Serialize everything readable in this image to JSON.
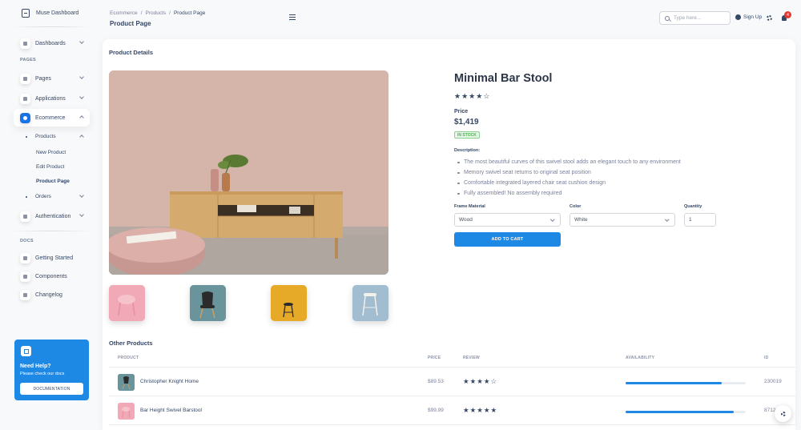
{
  "brand": {
    "name": "Muse Dashboard"
  },
  "sidebar": {
    "dashboards": "Dashboards",
    "section_pages": "PAGES",
    "pages": "Pages",
    "applications": "Applications",
    "ecommerce": "Ecommerce",
    "products": "Products",
    "new_product": "New Product",
    "edit_product": "Edit Product",
    "product_page": "Product Page",
    "orders": "Orders",
    "authentication": "Authentication",
    "section_docs": "DOCS",
    "getting_started": "Getting Started",
    "components": "Components",
    "changelog": "Changelog"
  },
  "help": {
    "title": "Need Help?",
    "subtitle": "Please check our docs",
    "button": "DOCUMENTATION"
  },
  "header": {
    "breadcrumb": [
      "Ecommerce",
      "Products",
      "Product Page"
    ],
    "title": "Product Page",
    "search_placeholder": "Type here...",
    "signup": "Sign Up",
    "notification_count": "4"
  },
  "product": {
    "section_title": "Product Details",
    "name": "Minimal Bar Stool",
    "rating": 4,
    "price_label": "Price",
    "price": "$1,419",
    "stock": "IN STOCK",
    "description_label": "Description:",
    "description": [
      "The most beautiful curves of this swivel stool adds an elegant touch to any environment",
      "Memory swivel seat returns to original seat position",
      "Comfortable integrated layered chair seat cushion design",
      "Fully assembled! No assembly required"
    ],
    "frame_label": "Frame Material",
    "frame_value": "Wood",
    "color_label": "Color",
    "color_value": "White",
    "quantity_label": "Quantity",
    "quantity_value": "1",
    "add_to_cart": "ADD TO CART"
  },
  "other_products": {
    "title": "Other Products",
    "columns": [
      "PRODUCT",
      "PRICE",
      "REVIEW",
      "AVAILABILITY",
      "ID"
    ],
    "rows": [
      {
        "name": "Christopher Knight Home",
        "price": "$89.53",
        "rating": 4,
        "availability": 0.8,
        "id": "230019"
      },
      {
        "name": "Bar Height Swivel Barstool",
        "price": "$99.99",
        "rating": 5,
        "availability": 0.9,
        "id": "8712"
      }
    ]
  },
  "colors": {
    "primary": "#1e88e5",
    "success": "#4caf50",
    "danger": "#e53935",
    "text": "#344767"
  }
}
